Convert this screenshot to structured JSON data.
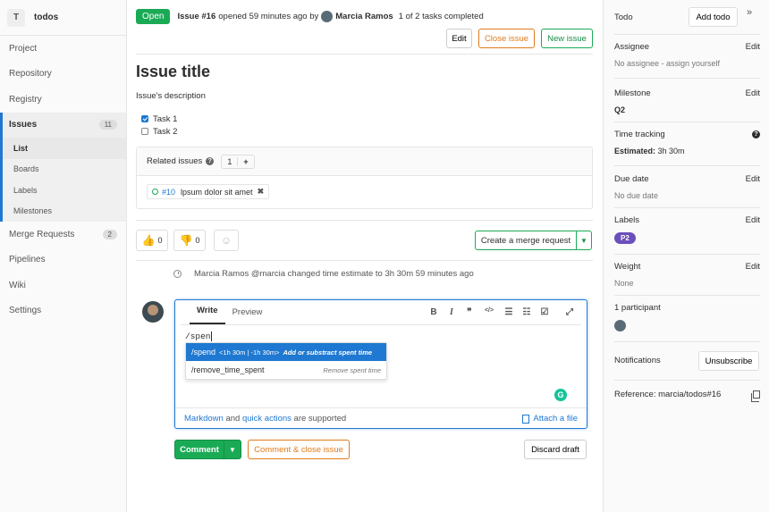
{
  "sidebar": {
    "project_initial": "T",
    "project_name": "todos",
    "items": [
      {
        "label": "Project"
      },
      {
        "label": "Repository"
      },
      {
        "label": "Registry"
      },
      {
        "label": "Issues",
        "badge": "11"
      },
      {
        "label": "Merge Requests",
        "badge": "2"
      },
      {
        "label": "Pipelines"
      },
      {
        "label": "Wiki"
      },
      {
        "label": "Settings"
      }
    ],
    "subitems": [
      "List",
      "Boards",
      "Labels",
      "Milestones"
    ]
  },
  "header": {
    "status": "Open",
    "issue_ref": "Issue #16",
    "opened_text": "opened 59 minutes ago by",
    "author": "Marcia Ramos",
    "tasks_text": "1 of 2 tasks completed",
    "edit_label": "Edit",
    "close_label": "Close issue",
    "new_label": "New issue"
  },
  "issue": {
    "title": "Issue title",
    "description": "Issue's description",
    "tasks": [
      {
        "label": "Task 1",
        "checked": true
      },
      {
        "label": "Task 2",
        "checked": false
      }
    ]
  },
  "related": {
    "title": "Related issues",
    "help": "?",
    "count": "1",
    "add": "+",
    "item_ref": "#10",
    "item_title": "lpsum dolor sit amet",
    "remove": "✖"
  },
  "awards": {
    "thumbsup": "0",
    "thumbsdown": "0"
  },
  "merge": {
    "label": "Create a merge request",
    "dropdown": "▼"
  },
  "timeline": {
    "text": "Marcia Ramos @marcia changed time estimate to 3h 30m 59 minutes ago"
  },
  "editor": {
    "tab_write": "Write",
    "tab_preview": "Preview",
    "tools": [
      "B",
      "I",
      "❞",
      "</>",
      "☰",
      "☷",
      "☑",
      "⤢"
    ],
    "input": "/spen",
    "suggestions": [
      {
        "command": "/spend",
        "args": "<1h 30m | -1h 30m>",
        "hint": "Add or substract spent time"
      },
      {
        "command": "/remove_time_spent",
        "args": "",
        "hint": "Remove spent time"
      }
    ],
    "footer_markdown": "Markdown",
    "footer_and": "and",
    "footer_quick": "quick actions",
    "footer_supported": "are supported",
    "attach": "Attach a file",
    "grammarly": "G"
  },
  "actions": {
    "comment": "Comment",
    "comment_close": "Comment & close issue",
    "discard": "Discard draft"
  },
  "right": {
    "todo": "Todo",
    "add_todo": "Add todo",
    "collapse": "»",
    "assignee_title": "Assignee",
    "assignee_value": "No assignee - assign yourself",
    "milestone_title": "Milestone",
    "milestone_value": "Q2",
    "time_title": "Time tracking",
    "time_help": "?",
    "time_value_label": "Estimated:",
    "time_value": "3h 30m",
    "due_title": "Due date",
    "due_value": "No due date",
    "labels_title": "Labels",
    "label_p2": "P2",
    "weight_title": "Weight",
    "weight_value": "None",
    "participants_title": "1 participant",
    "notifications_title": "Notifications",
    "unsubscribe": "Unsubscribe",
    "reference": "Reference: marcia/todos#16",
    "edit": "Edit"
  },
  "colors": {
    "green": "#1aaa55",
    "blue": "#1f78d1",
    "orange": "#e07b1c",
    "purple": "#6b4fbb"
  }
}
